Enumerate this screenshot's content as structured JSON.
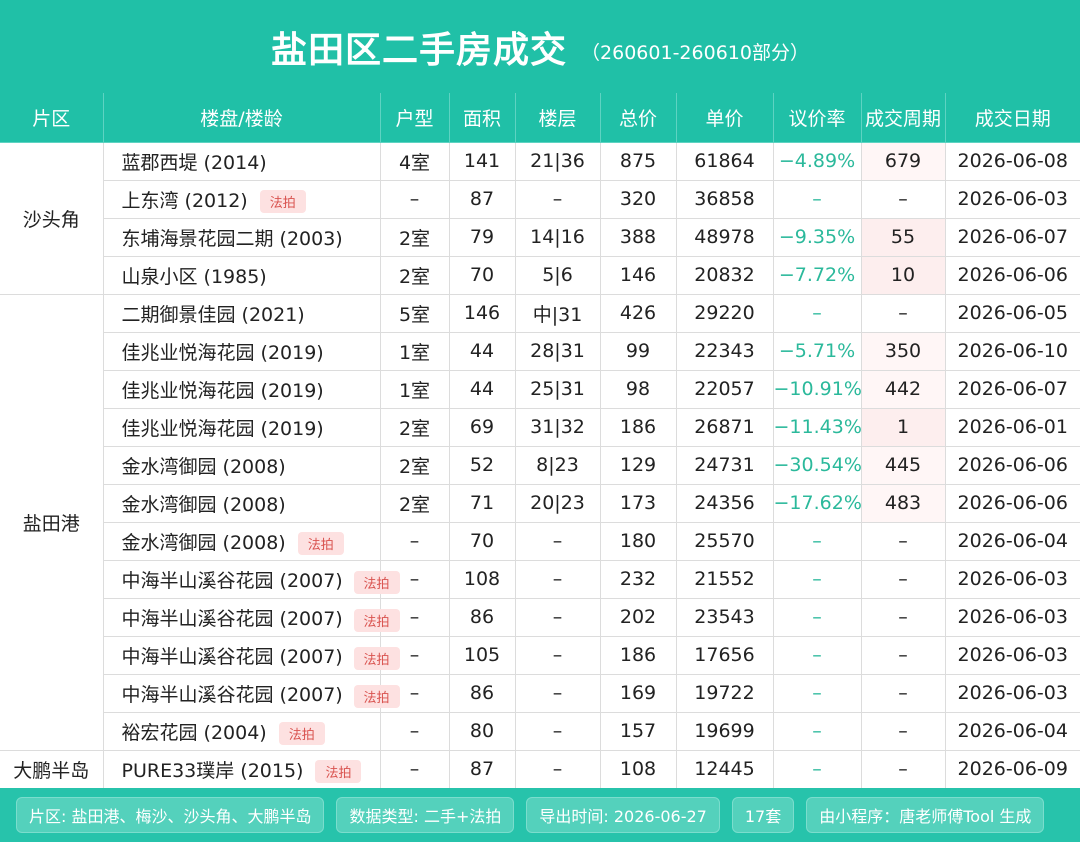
{
  "header": {
    "title": "盐田区二手房成交",
    "subtitle": "（260601-260610部分）"
  },
  "columns": [
    "片区",
    "楼盘/楼龄",
    "户型",
    "面积",
    "楼层",
    "总价",
    "单价",
    "议价率",
    "成交周期",
    "成交日期"
  ],
  "tag_label": "法拍",
  "areas": [
    "沙头角",
    "盐田港",
    "大鹏半岛"
  ],
  "rows": [
    {
      "name": "蓝郡西堤 (2014)",
      "rooms": "4室",
      "size": "141",
      "floor": "21|36",
      "total": "875",
      "unit": "61864",
      "rate": "−4.89%",
      "cycle": "679",
      "date": "2026-06-08"
    },
    {
      "name": "上东湾 (2012)",
      "rooms": "–",
      "size": "87",
      "floor": "–",
      "total": "320",
      "unit": "36858",
      "rate": "–",
      "cycle": "–",
      "date": "2026-06-03"
    },
    {
      "name": "东埔海景花园二期 (2003)",
      "rooms": "2室",
      "size": "79",
      "floor": "14|16",
      "total": "388",
      "unit": "48978",
      "rate": "−9.35%",
      "cycle": "55",
      "date": "2026-06-07"
    },
    {
      "name": "山泉小区 (1985)",
      "rooms": "2室",
      "size": "70",
      "floor": "5|6",
      "total": "146",
      "unit": "20832",
      "rate": "−7.72%",
      "cycle": "10",
      "date": "2026-06-06"
    },
    {
      "name": "二期御景佳园 (2021)",
      "rooms": "5室",
      "size": "146",
      "floor": "中|31",
      "total": "426",
      "unit": "29220",
      "rate": "–",
      "cycle": "–",
      "date": "2026-06-05"
    },
    {
      "name": "佳兆业悦海花园 (2019)",
      "rooms": "1室",
      "size": "44",
      "floor": "28|31",
      "total": "99",
      "unit": "22343",
      "rate": "−5.71%",
      "cycle": "350",
      "date": "2026-06-10"
    },
    {
      "name": "佳兆业悦海花园 (2019)",
      "rooms": "1室",
      "size": "44",
      "floor": "25|31",
      "total": "98",
      "unit": "22057",
      "rate": "−10.91%",
      "cycle": "442",
      "date": "2026-06-07"
    },
    {
      "name": "佳兆业悦海花园 (2019)",
      "rooms": "2室",
      "size": "69",
      "floor": "31|32",
      "total": "186",
      "unit": "26871",
      "rate": "−11.43%",
      "cycle": "1",
      "date": "2026-06-01"
    },
    {
      "name": "金水湾御园 (2008)",
      "rooms": "2室",
      "size": "52",
      "floor": "8|23",
      "total": "129",
      "unit": "24731",
      "rate": "−30.54%",
      "cycle": "445",
      "date": "2026-06-06"
    },
    {
      "name": "金水湾御园 (2008)",
      "rooms": "2室",
      "size": "71",
      "floor": "20|23",
      "total": "173",
      "unit": "24356",
      "rate": "−17.62%",
      "cycle": "483",
      "date": "2026-06-06"
    },
    {
      "name": "金水湾御园 (2008)",
      "rooms": "–",
      "size": "70",
      "floor": "–",
      "total": "180",
      "unit": "25570",
      "rate": "–",
      "cycle": "–",
      "date": "2026-06-04"
    },
    {
      "name": "中海半山溪谷花园 (2007)",
      "rooms": "–",
      "size": "108",
      "floor": "–",
      "total": "232",
      "unit": "21552",
      "rate": "–",
      "cycle": "–",
      "date": "2026-06-03"
    },
    {
      "name": "中海半山溪谷花园 (2007)",
      "rooms": "–",
      "size": "86",
      "floor": "–",
      "total": "202",
      "unit": "23543",
      "rate": "–",
      "cycle": "–",
      "date": "2026-06-03"
    },
    {
      "name": "中海半山溪谷花园 (2007)",
      "rooms": "–",
      "size": "105",
      "floor": "–",
      "total": "186",
      "unit": "17656",
      "rate": "–",
      "cycle": "–",
      "date": "2026-06-03"
    },
    {
      "name": "中海半山溪谷花园 (2007)",
      "rooms": "–",
      "size": "86",
      "floor": "–",
      "total": "169",
      "unit": "19722",
      "rate": "–",
      "cycle": "–",
      "date": "2026-06-03"
    },
    {
      "name": "裕宏花园 (2004)",
      "rooms": "–",
      "size": "80",
      "floor": "–",
      "total": "157",
      "unit": "19699",
      "rate": "–",
      "cycle": "–",
      "date": "2026-06-04"
    },
    {
      "name": "PURE33璞岸 (2015)",
      "rooms": "–",
      "size": "87",
      "floor": "–",
      "total": "108",
      "unit": "12445",
      "rate": "–",
      "cycle": "–",
      "date": "2026-06-09"
    }
  ],
  "footer": {
    "area": "片区: 盐田港、梅沙、沙头角、大鹏半岛",
    "type": "数据类型: 二手+法拍",
    "export": "导出时间: 2026-06-27",
    "count": "17套",
    "source": "由小程序：唐老师傅Tool 生成"
  },
  "colors": {
    "header_bg": "#20c0a7",
    "rate_text": "#2bb99b",
    "tag_bg": "#fde1e1",
    "tag_text": "#d9534f"
  }
}
